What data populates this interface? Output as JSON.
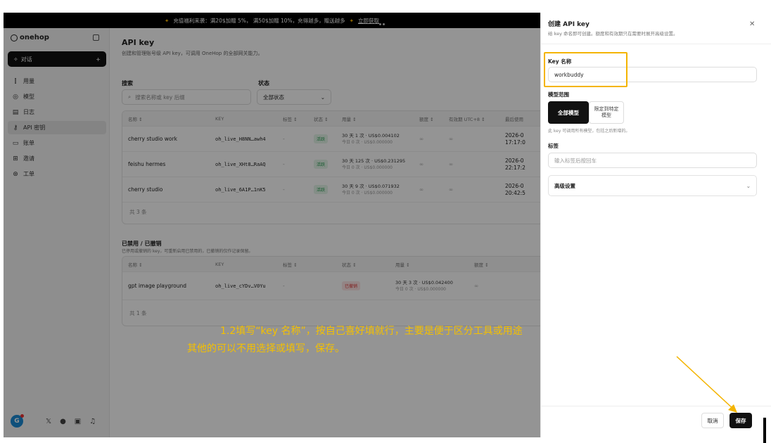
{
  "banner": {
    "text": "充值福利来袭：满20$加赠 5%， 满50$加赠 10%，充得越多，赠送越多",
    "cta": "立即获取"
  },
  "sidebar": {
    "logo": "onehop",
    "chat_label": "对话",
    "items": [
      {
        "icon": "chart-icon",
        "glyph": "⫿",
        "label": "用量"
      },
      {
        "icon": "model-icon",
        "glyph": "◎",
        "label": "模型"
      },
      {
        "icon": "log-icon",
        "glyph": "▤",
        "label": "日志"
      },
      {
        "icon": "key-icon",
        "glyph": "⚷",
        "label": "API 密钥"
      },
      {
        "icon": "bill-icon",
        "glyph": "▭",
        "label": "账单"
      },
      {
        "icon": "invite-icon",
        "glyph": "⊞",
        "label": "邀请"
      },
      {
        "icon": "ticket-icon",
        "glyph": "⊛",
        "label": "工单"
      }
    ],
    "avatar_letter": "G"
  },
  "main": {
    "title": "API key",
    "subtitle": "创建和管理账号级 API key，可调用 OneHop 的全部网关能力。",
    "search_label": "搜索",
    "search_placeholder": "搜索名称或 key 后缀",
    "status_label": "状态",
    "status_value": "全部状态",
    "columns": [
      "名称 ↕",
      "KEY",
      "标签 ↕",
      "状态 ↕",
      "用量 ↕",
      "额度 ↕",
      "有效期 UTC+8 ↕",
      "最后使用"
    ],
    "rows": [
      {
        "name": "cherry studio work",
        "key": "oh_live_H8NN…awh4",
        "tag": "-",
        "status": "活跃",
        "usage1": "30 天 1 次 · US$0.004102",
        "usage2": "今日 0 次 · US$0.000000",
        "quota": "∞",
        "expiry": "∞",
        "last": "2026-0",
        "last2": "17:17:0"
      },
      {
        "name": "feishu hermes",
        "key": "oh_live_XHt8…RaAQ",
        "tag": "-",
        "status": "活跃",
        "usage1": "30 天 125 次 · US$0.231295",
        "usage2": "今日 0 次 · US$0.000000",
        "quota": "∞",
        "expiry": "∞",
        "last": "2026-0",
        "last2": "22:17:2"
      },
      {
        "name": "cherry studio",
        "key": "oh_live_6A1P…1nK5",
        "tag": "-",
        "status": "活跃",
        "usage1": "30 天 9 次 · US$0.071932",
        "usage2": "今日 0 次 · US$0.000000",
        "quota": "∞",
        "expiry": "∞",
        "last": "2026-0",
        "last2": "20:42:5"
      }
    ],
    "total": "共 3 条",
    "disabled_title": "已禁用 / 已撤销",
    "disabled_sub": "已停用或撤销的 key，可重新启用已禁用的，已撤销的仅作记录保留。",
    "disabled_columns": [
      "名称 ↕",
      "KEY",
      "标签 ↕",
      "状态 ↕",
      "用量 ↕",
      "额度 ↕"
    ],
    "disabled_rows": [
      {
        "name": "gpt image playground",
        "key": "oh_live_cYDv…V0Yu",
        "tag": "-",
        "status": "已撤销",
        "usage1": "30 天 3 次 · US$0.042400",
        "usage2": "今日 0 次 · US$0.000000",
        "quota": "∞"
      }
    ],
    "disabled_total": "共 1 条"
  },
  "drawer": {
    "title": "创建 API key",
    "subtitle": "给 key 命名即可创建。额度和有效期只在需要时展开高级设置。",
    "name_label": "Key 名称",
    "name_value": "workbuddy",
    "scope_label": "模型范围",
    "scope_all": "全部模型",
    "scope_specific": "限定到特定模型",
    "scope_hint": "此 key 可调用所有模型，包括之后新增的。",
    "tag_label": "标签",
    "tag_placeholder": "输入标签后按回车",
    "advanced": "高级设置",
    "cancel": "取消",
    "save": "保存"
  },
  "annotation": {
    "line1": "1.2填写“key 名称”，按自己喜好填就行，主要是便于区分工具或用途",
    "line2": "其他的可以不用选择或填写，保存。",
    "color": "#f4c000"
  }
}
